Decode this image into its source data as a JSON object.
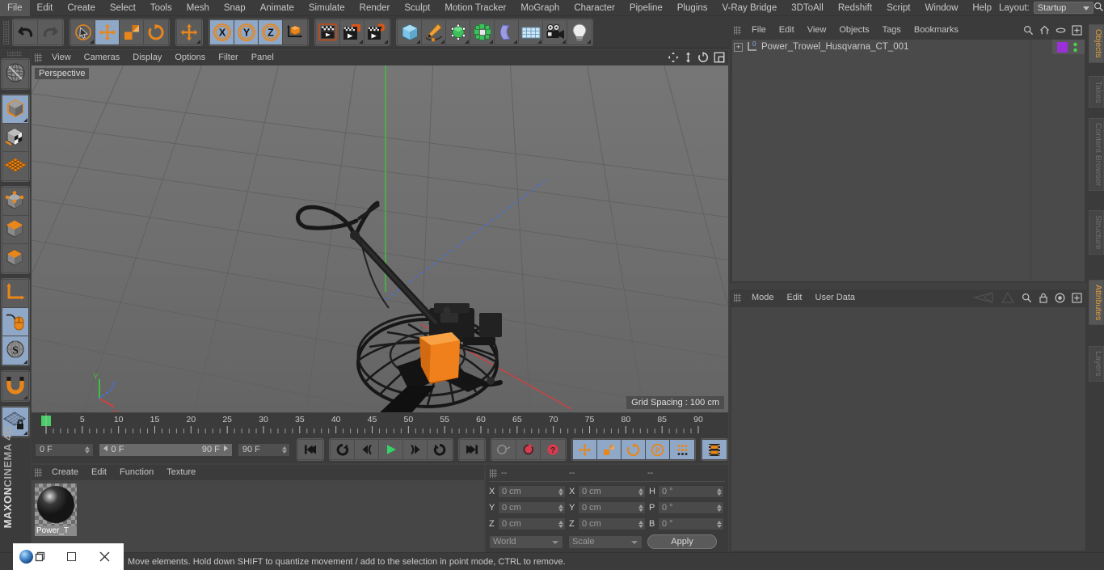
{
  "menubar": {
    "items": [
      "File",
      "Edit",
      "Create",
      "Select",
      "Tools",
      "Mesh",
      "Snap",
      "Animate",
      "Simulate",
      "Render",
      "Sculpt",
      "Motion Tracker",
      "MoGraph",
      "Character",
      "Pipeline",
      "Plugins",
      "V-Ray Bridge",
      "3DToAll",
      "Redshift",
      "Script",
      "Window",
      "Help"
    ],
    "layout_label": "Layout:",
    "layout_value": "Startup",
    "search_icon": "magnifier-icon"
  },
  "toolbar": {
    "groups": [
      {
        "name": "history",
        "buttons": [
          {
            "name": "undo-button",
            "icon": "undo-arrow-icon",
            "selected": false
          },
          {
            "name": "redo-button",
            "icon": "redo-arrow-icon",
            "selected": false,
            "disabled": true
          }
        ]
      },
      {
        "name": "transform-tools",
        "buttons": [
          {
            "name": "live-selection-tool",
            "icon": "cursor-circle-icon",
            "selected": false,
            "corner": true
          },
          {
            "name": "move-tool",
            "icon": "move-arrows-icon",
            "selected": true
          },
          {
            "name": "scale-tool",
            "icon": "scale-box-icon",
            "selected": false
          },
          {
            "name": "rotate-tool",
            "icon": "rotate-arc-icon",
            "selected": false
          }
        ]
      },
      {
        "name": "free-move-tool-group",
        "buttons": [
          {
            "name": "free-move-tool",
            "icon": "move-arrows-icon",
            "selected": false,
            "corner": true
          }
        ]
      },
      {
        "name": "axis-locks",
        "buttons": [
          {
            "name": "lock-x-axis-button",
            "icon": "x-axis-icon",
            "label": "X",
            "selected": true
          },
          {
            "name": "lock-y-axis-button",
            "icon": "y-axis-icon",
            "label": "Y",
            "selected": true
          },
          {
            "name": "lock-z-axis-button",
            "icon": "z-axis-icon",
            "label": "Z",
            "selected": true
          },
          {
            "name": "world-object-coordinate-button",
            "icon": "world-axis-cube-icon",
            "selected": false
          }
        ]
      },
      {
        "name": "render-tools",
        "buttons": [
          {
            "name": "render-view-button",
            "icon": "clapperboard-icon",
            "selected": false
          },
          {
            "name": "render-to-picture-viewer-button",
            "icon": "clapperboard-picture-icon",
            "selected": false,
            "corner": true
          },
          {
            "name": "render-settings-button",
            "icon": "clapperboard-gear-icon",
            "selected": false,
            "corner": true
          }
        ]
      },
      {
        "name": "create-objects",
        "buttons": [
          {
            "name": "add-cube-button",
            "icon": "cube-icon",
            "selected": false,
            "corner": true
          },
          {
            "name": "add-spline-button",
            "icon": "pen-spline-icon",
            "selected": false,
            "corner": true
          },
          {
            "name": "add-generator-button",
            "icon": "green-cube-generator-icon",
            "selected": false,
            "corner": true
          },
          {
            "name": "add-mograph-button",
            "icon": "mograph-cluster-icon",
            "selected": false,
            "corner": true
          },
          {
            "name": "add-deformer-button",
            "icon": "bend-deformer-icon",
            "selected": false,
            "corner": true
          },
          {
            "name": "add-scene-object-button",
            "icon": "floor-grid-icon",
            "selected": false,
            "corner": true
          },
          {
            "name": "add-camera-button",
            "icon": "camera-icon",
            "selected": false,
            "corner": true
          },
          {
            "name": "add-light-button",
            "icon": "light-bulb-icon",
            "selected": false,
            "corner": true
          }
        ]
      }
    ]
  },
  "left_toolbar": {
    "groups": [
      {
        "name": "make-editable-group",
        "buttons": [
          {
            "name": "make-editable-button",
            "icon": "globe-wireframe-icon",
            "selected": false
          }
        ]
      },
      {
        "name": "mode-group",
        "buttons": [
          {
            "name": "model-mode-button",
            "icon": "model-cube-icon",
            "selected": true,
            "corner": true
          },
          {
            "name": "texture-mode-button",
            "icon": "texture-checker-cube-icon",
            "selected": false
          },
          {
            "name": "workplane-mode-button",
            "icon": "workplane-grid-icon",
            "selected": false
          }
        ]
      },
      {
        "name": "component-group",
        "buttons": [
          {
            "name": "points-mode-button",
            "icon": "points-cube-icon",
            "selected": false
          },
          {
            "name": "edges-mode-button",
            "icon": "edges-cube-icon",
            "selected": false
          },
          {
            "name": "polygons-mode-button",
            "icon": "polygons-cube-icon",
            "selected": false
          }
        ]
      },
      {
        "name": "axis-group",
        "buttons": [
          {
            "name": "enable-axis-button",
            "icon": "axis-corner-icon",
            "selected": false
          },
          {
            "name": "viewport-solo-button",
            "icon": "mouse-icon",
            "selected": true
          },
          {
            "name": "snap-button",
            "icon": "snap-s-icon",
            "selected": true,
            "corner": true
          }
        ]
      },
      {
        "name": "magnet-group",
        "buttons": [
          {
            "name": "magnet-tool-button",
            "icon": "magnet-icon",
            "selected": false,
            "corner": true
          }
        ]
      },
      {
        "name": "workplane-lock-group",
        "buttons": [
          {
            "name": "workplane-lock-button",
            "icon": "workplane-lock-icon",
            "selected": true,
            "corner": true
          }
        ]
      }
    ],
    "brand_maxon": "MAXON",
    "brand_product": "CINEMA 4D"
  },
  "viewport": {
    "menu_items": [
      "View",
      "Cameras",
      "Display",
      "Options",
      "Filter",
      "Panel"
    ],
    "view_label": "Perspective",
    "grid_spacing": "Grid Spacing : 100 cm",
    "nav_icons": [
      {
        "name": "pan-view-icon"
      },
      {
        "name": "dolly-view-icon"
      },
      {
        "name": "rotate-view-icon"
      },
      {
        "name": "maximize-view-icon"
      }
    ],
    "axis_gizmo": {
      "x_label": "X",
      "y_label": "Y",
      "z_label": "Z",
      "x_color": "#d44040",
      "y_color": "#3fc03f",
      "z_color": "#4a6fd8"
    },
    "background_color": "#6e6e6e",
    "model_name": "power-trowel-machine"
  },
  "timeline": {
    "ticks": [
      "0",
      "5",
      "10",
      "15",
      "20",
      "25",
      "30",
      "35",
      "40",
      "45",
      "50",
      "55",
      "60",
      "65",
      "70",
      "75",
      "80",
      "85",
      "90"
    ],
    "playhead_frame": 0,
    "current_frame_right": "0 F",
    "current_frame_left": "0 F",
    "range_start": "0 F",
    "range_end": "90 F",
    "end_frame": "90 F"
  },
  "transport": {
    "buttons": [
      {
        "name": "go-to-start-button",
        "icon": "skip-start-icon"
      },
      {
        "name": "previous-keyframe-button",
        "icon": "prev-key-icon"
      },
      {
        "name": "step-back-button",
        "icon": "step-back-icon"
      },
      {
        "name": "play-button",
        "icon": "play-icon"
      },
      {
        "name": "step-forward-button",
        "icon": "step-forward-icon"
      },
      {
        "name": "next-keyframe-button",
        "icon": "next-key-icon"
      },
      {
        "name": "go-to-end-button",
        "icon": "skip-end-icon"
      }
    ],
    "keyframe_buttons": [
      {
        "name": "record-active-objects-button",
        "icon": "key-icon"
      },
      {
        "name": "autokeying-button",
        "icon": "autokey-circle-icon"
      },
      {
        "name": "keyframe-selection-button",
        "icon": "key-question-icon"
      }
    ],
    "channel_buttons": [
      {
        "name": "position-channel-button",
        "icon": "move-arrows-icon",
        "selected": true
      },
      {
        "name": "scale-channel-button",
        "icon": "scale-box-icon",
        "selected": true
      },
      {
        "name": "rotation-channel-button",
        "icon": "rotate-arc-icon",
        "selected": true
      },
      {
        "name": "parameter-channel-button",
        "icon": "p-circle-icon",
        "selected": true
      },
      {
        "name": "point-level-animation-button",
        "icon": "pla-dots-icon",
        "selected": true
      }
    ],
    "film_button": {
      "name": "timeline-toggle-button",
      "icon": "film-strip-icon",
      "selected": true
    }
  },
  "material_manager": {
    "menu_items": [
      "Create",
      "Edit",
      "Function",
      "Texture"
    ],
    "materials": [
      {
        "name": "Power_T"
      }
    ]
  },
  "coordinate_manager": {
    "header": [
      "--",
      "--",
      "--"
    ],
    "rows": [
      {
        "pos_label": "X",
        "pos_value": "0 cm",
        "size_label": "X",
        "size_value": "0 cm",
        "rot_label": "H",
        "rot_value": "0 °"
      },
      {
        "pos_label": "Y",
        "pos_value": "0 cm",
        "size_label": "Y",
        "size_value": "0 cm",
        "rot_label": "P",
        "rot_value": "0 °"
      },
      {
        "pos_label": "Z",
        "pos_value": "0 cm",
        "size_label": "Z",
        "size_value": "0 cm",
        "rot_label": "B",
        "rot_value": "0 °"
      }
    ],
    "system_dropdown": "World",
    "mode_dropdown": "Scale",
    "apply_label": "Apply"
  },
  "object_manager": {
    "menu_items": [
      "File",
      "Edit",
      "View",
      "Objects",
      "Tags",
      "Bookmarks"
    ],
    "header_icons": [
      {
        "name": "search-icon"
      },
      {
        "name": "home-icon"
      },
      {
        "name": "ellipse-icon"
      },
      {
        "name": "add-panel-icon"
      }
    ],
    "objects": [
      {
        "name": "Power_Trowel_Husqvarna_CT_001",
        "layer_badge": "0",
        "material_tag_color": "#9b30d9",
        "visible_dots": "#4cd24c"
      }
    ]
  },
  "attribute_manager": {
    "menu_items": [
      "Mode",
      "Edit",
      "User Data"
    ],
    "header_icons": [
      {
        "name": "arrow-back-icon"
      },
      {
        "name": "arrow-forward-icon"
      },
      {
        "name": "search-icon"
      },
      {
        "name": "lock-icon"
      },
      {
        "name": "target-icon"
      },
      {
        "name": "add-panel-icon"
      }
    ]
  },
  "tabstrip": {
    "tabs": [
      {
        "label": "Objects",
        "active": true
      },
      {
        "label": "Takes",
        "active": false
      },
      {
        "label": "Content Browser",
        "active": false
      },
      {
        "label": "Structure",
        "active": false
      },
      {
        "label": "Attributes",
        "active": true
      },
      {
        "label": "Layers",
        "active": false
      }
    ]
  },
  "statusbar": {
    "message": "Move elements. Hold down SHIFT to quantize movement / add to the selection in point mode, CTRL to remove."
  },
  "overlay_window": {
    "app_icon": "cinema4d-orb-icon",
    "restore_icon": "restore-window-icon",
    "maximize_icon": "maximize-window-icon",
    "close_icon": "close-window-icon"
  },
  "colors": {
    "panel_bg": "#3b3b3b",
    "viewport_bg": "#6e6e6e",
    "selection_blue": "#8fa8c8",
    "accent_orange": "#e8861a",
    "tab_active": "#e0a03c"
  }
}
